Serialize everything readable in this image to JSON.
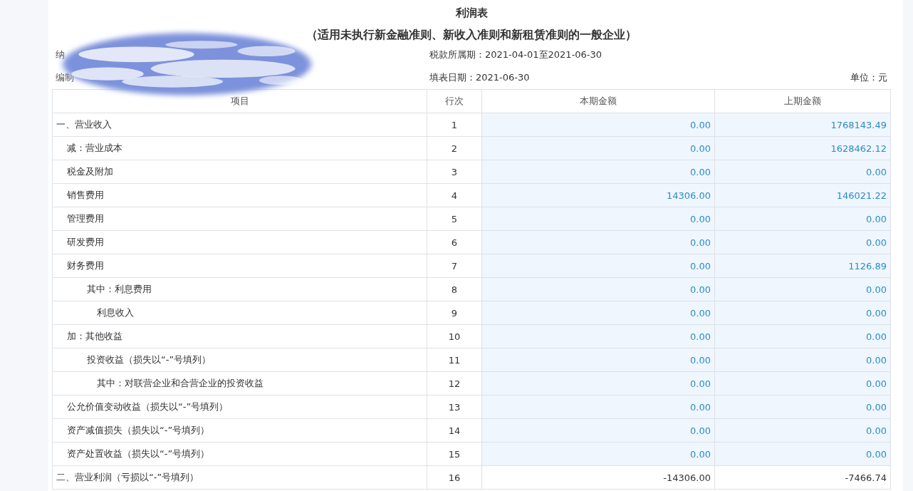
{
  "report": {
    "title": "利润表",
    "subtitle": "（适用未执行新金融准则、新收入准则和新租赁准则的一般企业）",
    "taxpayer_label": "纳",
    "preparer_label": "编制",
    "period": "税款所属期：2021-04-01至2021-06-30",
    "fill_date": "填表日期：2021-06-30",
    "unit": "单位：元"
  },
  "table": {
    "columns": [
      "项目",
      "行次",
      "本期金额",
      "上期金额"
    ],
    "rows": [
      {
        "item": "一、营业收入",
        "line": "1",
        "current": "0.00",
        "previous": "1768143.49",
        "kind": "input",
        "children": [
          {
            "item": "减：营业成本",
            "line": "2",
            "current": "0.00",
            "previous": "1628462.12",
            "kind": "input"
          },
          {
            "item": "税金及附加",
            "line": "3",
            "current": "0.00",
            "previous": "0.00",
            "kind": "input"
          },
          {
            "item": "销售费用",
            "line": "4",
            "current": "14306.00",
            "previous": "146021.22",
            "kind": "input"
          },
          {
            "item": "管理费用",
            "line": "5",
            "current": "0.00",
            "previous": "0.00",
            "kind": "input"
          },
          {
            "item": "研发费用",
            "line": "6",
            "current": "0.00",
            "previous": "0.00",
            "kind": "input"
          },
          {
            "item": "财务费用",
            "line": "7",
            "current": "0.00",
            "previous": "1126.89",
            "kind": "input",
            "children": [
              {
                "item": "其中：利息费用",
                "line": "8",
                "current": "0.00",
                "previous": "0.00",
                "kind": "input",
                "children": [
                  {
                    "item": "利息收入",
                    "line": "9",
                    "current": "0.00",
                    "previous": "0.00",
                    "kind": "input"
                  }
                ]
              }
            ]
          },
          {
            "item": "加：其他收益",
            "line": "10",
            "current": "0.00",
            "previous": "0.00",
            "kind": "input",
            "children": [
              {
                "item": "投资收益（损失以“-”号填列）",
                "line": "11",
                "current": "0.00",
                "previous": "0.00",
                "kind": "input",
                "children": [
                  {
                    "item": "其中：对联营企业和合营企业的投资收益",
                    "line": "12",
                    "current": "0.00",
                    "previous": "0.00",
                    "kind": "input"
                  }
                ]
              }
            ]
          },
          {
            "item": "公允价值变动收益（损失以“-”号填列）",
            "line": "13",
            "current": "0.00",
            "previous": "0.00",
            "kind": "input"
          },
          {
            "item": "资产减值损失（损失以“-”号填列）",
            "line": "14",
            "current": "0.00",
            "previous": "0.00",
            "kind": "input"
          },
          {
            "item": "资产处置收益（损失以“-”号填列）",
            "line": "15",
            "current": "0.00",
            "previous": "0.00",
            "kind": "input"
          }
        ]
      },
      {
        "item": "二、营业利润（亏损以“-”号填列）",
        "line": "16",
        "current": "-14306.00",
        "previous": "-7466.74",
        "kind": "total"
      }
    ]
  }
}
